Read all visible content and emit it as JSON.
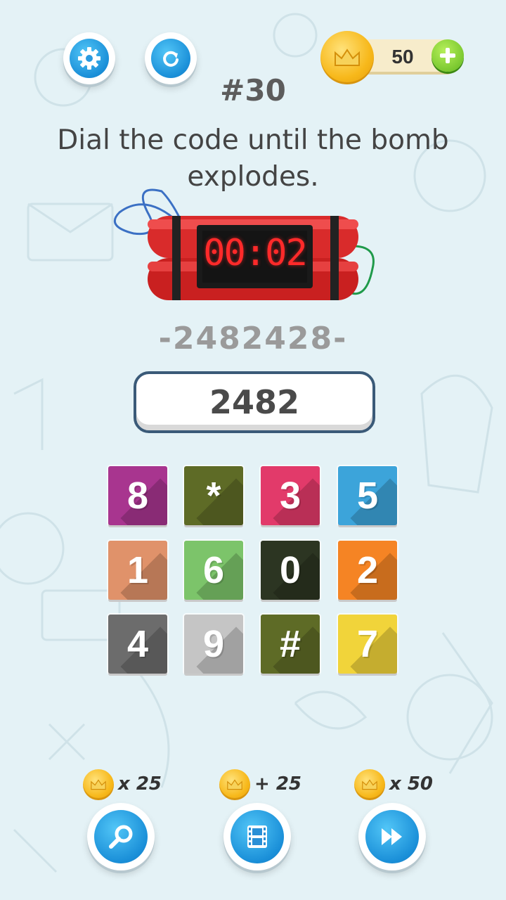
{
  "header": {
    "settings_icon": "gear-icon",
    "restart_icon": "restart-icon",
    "coins": "50",
    "add_icon": "plus-icon"
  },
  "level": "#30",
  "question": "Dial the code until the bomb explodes.",
  "bomb": {
    "timer": "00:02"
  },
  "code_hint": "-2482428-",
  "entered_code": "2482",
  "keypad": [
    {
      "label": "8",
      "color": "#a8358f"
    },
    {
      "label": "*",
      "color": "#5e6b26"
    },
    {
      "label": "3",
      "color": "#e23a6a"
    },
    {
      "label": "5",
      "color": "#3ca4da"
    },
    {
      "label": "1",
      "color": "#e0926a"
    },
    {
      "label": "6",
      "color": "#7cc46a"
    },
    {
      "label": "0",
      "color": "#2c3522"
    },
    {
      "label": "2",
      "color": "#f58424"
    },
    {
      "label": "4",
      "color": "#6c6c6c"
    },
    {
      "label": "9",
      "color": "#c5c5c5"
    },
    {
      "label": "#",
      "color": "#5e6b26"
    },
    {
      "label": "7",
      "color": "#f1d43a"
    }
  ],
  "powerups": [
    {
      "cost": "x 25",
      "icon": "magnifier-icon"
    },
    {
      "cost": "+ 25",
      "icon": "film-icon"
    },
    {
      "cost": "x 50",
      "icon": "fast-forward-icon"
    }
  ]
}
